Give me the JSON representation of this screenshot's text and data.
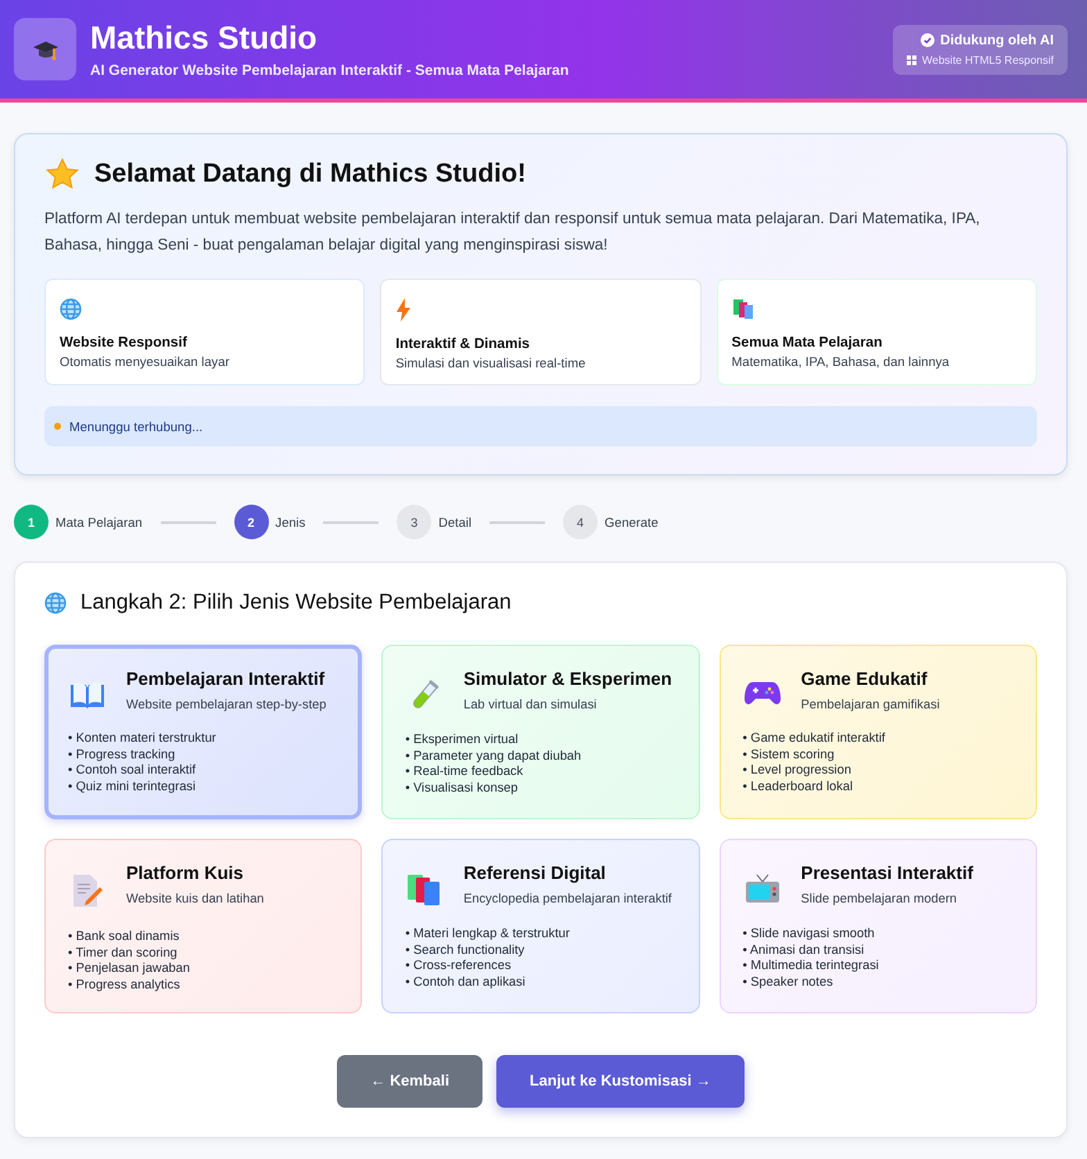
{
  "header": {
    "title": "Mathics Studio",
    "subtitle": "AI Generator Website Pembelajaran Interaktif - Semua Mata Pelajaran",
    "badge": {
      "title": "Didukung oleh AI",
      "subtitle": "Website HTML5 Responsif"
    }
  },
  "welcome": {
    "title": "Selamat Datang di Mathics Studio!",
    "description": "Platform AI terdepan untuk membuat website pembelajaran interaktif dan responsif untuk semua mata pelajaran. Dari Matematika, IPA, Bahasa, hingga Seni - buat pengalaman belajar digital yang menginspirasi siswa!",
    "features": [
      {
        "title": "Website Responsif",
        "description": "Otomatis menyesuaikan layar",
        "color": "#dbeafe"
      },
      {
        "title": "Interaktif & Dinamis",
        "description": "Simulasi dan visualisasi real-time",
        "color": "#e5e7eb"
      },
      {
        "title": "Semua Mata Pelajaran",
        "description": "Matematika, IPA, Bahasa, dan lainnya",
        "color": "#dcfce7"
      }
    ],
    "status": {
      "text": "Menunggu terhubung...",
      "color": "#f59e0b"
    }
  },
  "steps": [
    {
      "number": "1",
      "label": "Mata Pelajaran",
      "done": true,
      "selected": false
    },
    {
      "number": "2",
      "label": "Jenis",
      "done": false,
      "selected": true
    },
    {
      "number": "3",
      "label": "Detail",
      "done": false,
      "selected": false
    },
    {
      "number": "4",
      "label": "Generate",
      "done": false,
      "selected": false
    }
  ],
  "section": {
    "title": "Langkah 2: Pilih Jenis Website Pembelajaran",
    "types": [
      {
        "title": "Pembelajaran Interaktif",
        "subtitle": "Website pembelajaran step-by-step",
        "color": "#a5b4fc",
        "selected": true,
        "items": [
          "• Konten materi terstruktur",
          "• Progress tracking",
          "• Contoh soal interaktif",
          "• Quiz mini terintegrasi"
        ]
      },
      {
        "title": "Simulator & Eksperimen",
        "subtitle": "Lab virtual dan simulasi",
        "color": "#bbf7d0",
        "selected": false,
        "items": [
          "• Eksperimen virtual",
          "• Parameter yang dapat diubah",
          "• Real-time feedback",
          "• Visualisasi konsep"
        ]
      },
      {
        "title": "Game Edukatif",
        "subtitle": "Pembelajaran gamifikasi",
        "color": "#fde68a",
        "selected": false,
        "items": [
          "• Game edukatif interaktif",
          "• Sistem scoring",
          "• Level progression",
          "• Leaderboard lokal"
        ]
      },
      {
        "title": "Platform Kuis",
        "subtitle": "Website kuis dan latihan",
        "color": "#fecaca",
        "selected": false,
        "items": [
          "• Bank soal dinamis",
          "• Timer dan scoring",
          "• Penjelasan jawaban",
          "• Progress analytics"
        ]
      },
      {
        "title": "Referensi Digital",
        "subtitle": "Encyclopedia pembelajaran interaktif",
        "color": "#c7d2fe",
        "selected": false,
        "items": [
          "• Materi lengkap & terstruktur",
          "• Search functionality",
          "• Cross-references",
          "• Contoh dan aplikasi"
        ]
      },
      {
        "title": "Presentasi Interaktif",
        "subtitle": "Slide pembelajaran modern",
        "color": "#e9d5ff",
        "selected": false,
        "items": [
          "• Slide navigasi smooth",
          "• Animasi dan transisi",
          "• Multimedia terintegrasi",
          "• Speaker notes"
        ]
      }
    ]
  },
  "buttons": [
    {
      "label": "← Kembali",
      "kind": "secondary"
    },
    {
      "label": "Lanjut ke Kustomisasi →",
      "kind": "primary"
    }
  ]
}
